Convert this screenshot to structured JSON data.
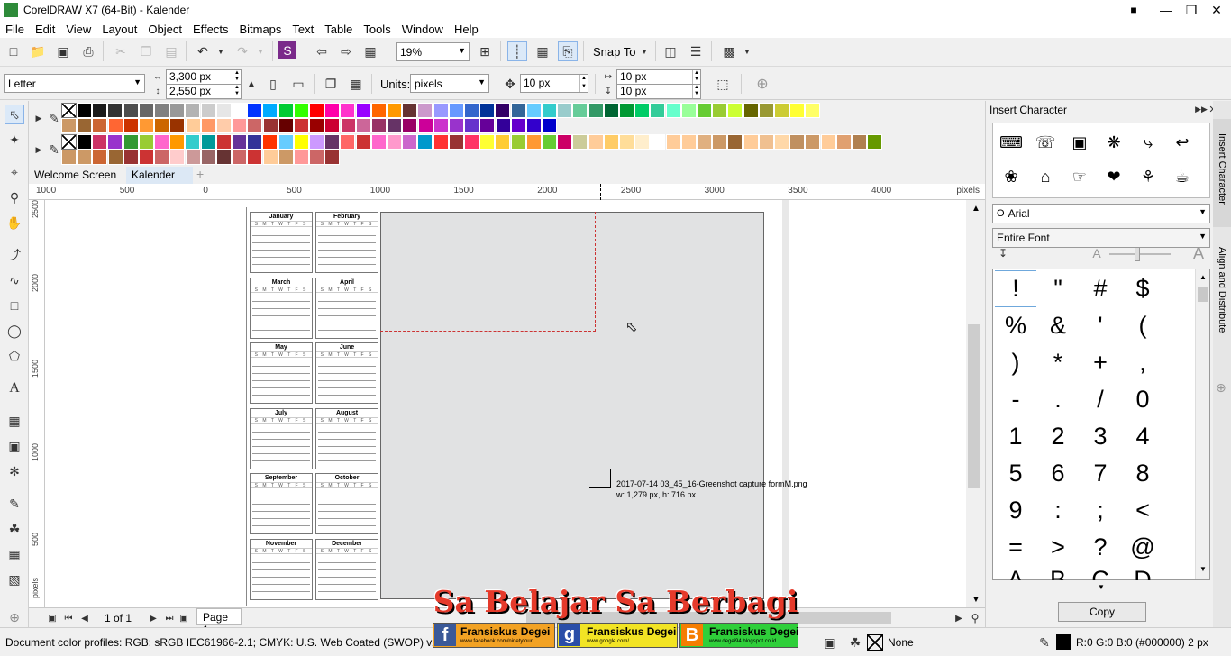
{
  "window": {
    "title": "CorelDRAW X7 (64-Bit) - Kalender"
  },
  "menu": [
    "File",
    "Edit",
    "View",
    "Layout",
    "Object",
    "Effects",
    "Bitmaps",
    "Text",
    "Table",
    "Tools",
    "Window",
    "Help"
  ],
  "toolbar": {
    "zoom": "19%",
    "snap_to": "Snap To"
  },
  "property_bar": {
    "page_size": "Letter",
    "width": "3,300 px",
    "height": "2,550 px",
    "units_label": "Units:",
    "units": "pixels",
    "nudge": "10 px",
    "dup_x": "10 px",
    "dup_y": "10 px"
  },
  "tabs": [
    {
      "label": "Welcome Screen"
    },
    {
      "label": "Kalender"
    }
  ],
  "ruler": {
    "h_ticks": [
      "1000",
      "500",
      "0",
      "500",
      "1000",
      "1500",
      "2000",
      "2500",
      "3000",
      "3500",
      "4000"
    ],
    "h_unit": "pixels",
    "v_ticks": [
      "2500",
      "2000",
      "1500",
      "1000",
      "500"
    ],
    "v_unit": "pixels"
  },
  "calendar": {
    "months": [
      "January",
      "February",
      "March",
      "April",
      "May",
      "June",
      "July",
      "August",
      "September",
      "October",
      "November",
      "December"
    ],
    "weekdays": "S M T W T F S"
  },
  "tooltip": {
    "line1": "2017-07-14 03_45_16-Greenshot capture formM.png",
    "line2": "w: 1,279 px, h: 716 px"
  },
  "page_nav": {
    "page_of": "1 of 1",
    "page_tab": "Page 1"
  },
  "docker": {
    "title": "Insert Character",
    "font": "Arial",
    "subset": "Entire Font",
    "chars": [
      "!",
      "\"",
      "#",
      "$",
      "%",
      "&",
      "'",
      "(",
      ")",
      "*",
      "+",
      ",",
      "-",
      ".",
      "/",
      "0",
      "1",
      "2",
      "3",
      "4",
      "5",
      "6",
      "7",
      "8",
      "9",
      ":",
      ";",
      "<",
      "=",
      ">",
      "?",
      "@"
    ],
    "copy_label": "Copy",
    "side_tabs": [
      "Insert Character",
      "Align and Distribute"
    ]
  },
  "watermark": {
    "title": "Sa Belajar Sa Berbagi",
    "badges": [
      {
        "letter": "f",
        "name": "Fransiskus Degei",
        "sub": "www.facebook.com/ninetyfour"
      },
      {
        "letter": "g",
        "name": "Fransiskus Degei",
        "sub": "www.google.com/"
      },
      {
        "letter": "B",
        "name": "Fransiskus Degei",
        "sub": "www.degei94.blogspot.co.id"
      }
    ]
  },
  "status": {
    "color_profiles": "Document color profiles: RGB: sRGB IEC61966-2.1; CMYK: U.S. Web Coated (SWOP) v2; Gra",
    "fill": "None",
    "outline": "R:0 G:0 B:0 (#000000)  2 px"
  },
  "palette_row1": [
    "#000000",
    "#1a1a1a",
    "#333333",
    "#4d4d4d",
    "#666666",
    "#808080",
    "#999999",
    "#b3b3b3",
    "#cccccc",
    "#e6e6e6",
    "#ffffff",
    "#0033ff",
    "#00aaff",
    "#00cc33",
    "#33ff00",
    "#ff0000",
    "#ff00aa",
    "#ff33cc",
    "#9900ff",
    "#ff6600",
    "#ff9900",
    "#663333",
    "#cc99cc",
    "#9999ff",
    "#6699ff",
    "#3366cc",
    "#003399",
    "#330066",
    "#336699",
    "#66ccff",
    "#33cccc",
    "#99cccc",
    "#66cc99",
    "#339966",
    "#006633",
    "#009933",
    "#00cc66",
    "#33cc99",
    "#66ffcc",
    "#99ff99",
    "#66cc33",
    "#99cc33",
    "#ccff33",
    "#666600",
    "#999933",
    "#cccc33",
    "#ffff33",
    "#ffff66"
  ],
  "palette_row2": [
    "#cc9966",
    "#996633",
    "#cc6633",
    "#ff6633",
    "#cc3300",
    "#ff9933",
    "#cc6600",
    "#993300",
    "#ffcc99",
    "#ff9966",
    "#ffccaa",
    "#ff9999",
    "#cc6666",
    "#993333",
    "#660000",
    "#cc3333",
    "#990000",
    "#cc0033",
    "#cc3366",
    "#cc6699",
    "#993366",
    "#663366",
    "#990066",
    "#cc0099",
    "#cc33cc",
    "#9933cc",
    "#6633cc",
    "#660099",
    "#330099",
    "#6600cc",
    "#3300cc",
    "#0000cc"
  ],
  "palette_row3": [
    "#000000",
    "#cc3366",
    "#9933cc",
    "#339933",
    "#99cc33",
    "#ff66cc",
    "#ff9900",
    "#33cccc",
    "#009999",
    "#cc3333",
    "#663399",
    "#333399",
    "#ff3300",
    "#66ccff",
    "#ffff00",
    "#cc99ff",
    "#663366",
    "#ff6666",
    "#cc3333",
    "#ff66cc",
    "#ff99cc",
    "#cc66cc",
    "#0099cc",
    "#ff3333",
    "#993333",
    "#ff3366",
    "#ffff33",
    "#ffcc33",
    "#99cc33",
    "#ff9933",
    "#66cc33",
    "#cc0066",
    "#cccc99",
    "#ffcc99",
    "#ffcc66",
    "#ffdd99",
    "#ffeecc",
    "#ffffff",
    "#ffcc99",
    "#ffcc99",
    "#e0b080",
    "#cc9966",
    "#996633",
    "#ffcc99",
    "#f0c090",
    "#ffd8a8",
    "#c09060",
    "#cc9966",
    "#ffcc99",
    "#e0a070",
    "#b08050",
    "#669900"
  ],
  "palette_row4": [
    "#cc9966",
    "#cc9966",
    "#cc6633",
    "#996633",
    "#993333",
    "#cc3333",
    "#cc6666",
    "#ffcccc",
    "#cc9999",
    "#996666",
    "#663333",
    "#cc6666",
    "#cc3333",
    "#ffcc99",
    "#cc9966",
    "#ff9999",
    "#cc6666",
    "#993333"
  ]
}
